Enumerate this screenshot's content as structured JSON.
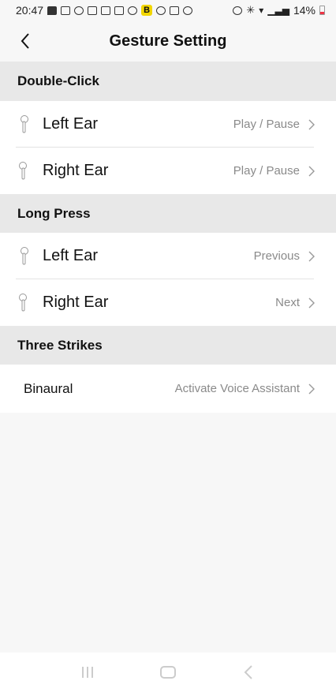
{
  "status_bar": {
    "time": "20:47",
    "battery_percent": "14%",
    "badge_letter": "B"
  },
  "header": {
    "title": "Gesture Setting"
  },
  "sections": [
    {
      "title": "Double-Click",
      "rows": [
        {
          "label": "Left Ear",
          "value": "Play / Pause"
        },
        {
          "label": "Right Ear",
          "value": "Play / Pause"
        }
      ]
    },
    {
      "title": "Long Press",
      "rows": [
        {
          "label": "Left Ear",
          "value": "Previous"
        },
        {
          "label": "Right Ear",
          "value": "Next"
        }
      ]
    },
    {
      "title": "Three Strikes",
      "rows": [
        {
          "label": "Binaural",
          "value": "Activate Voice Assistant"
        }
      ]
    }
  ],
  "icons": {
    "back": "back-arrow-icon",
    "earbud": "earbud-icon",
    "chevron": "chevron-right-icon"
  },
  "colors": {
    "section_bg": "#e8e8e8",
    "row_bg": "#ffffff",
    "value_text": "#8a8a8a",
    "battery_low": "#e34444",
    "badge": "#f2d600"
  }
}
